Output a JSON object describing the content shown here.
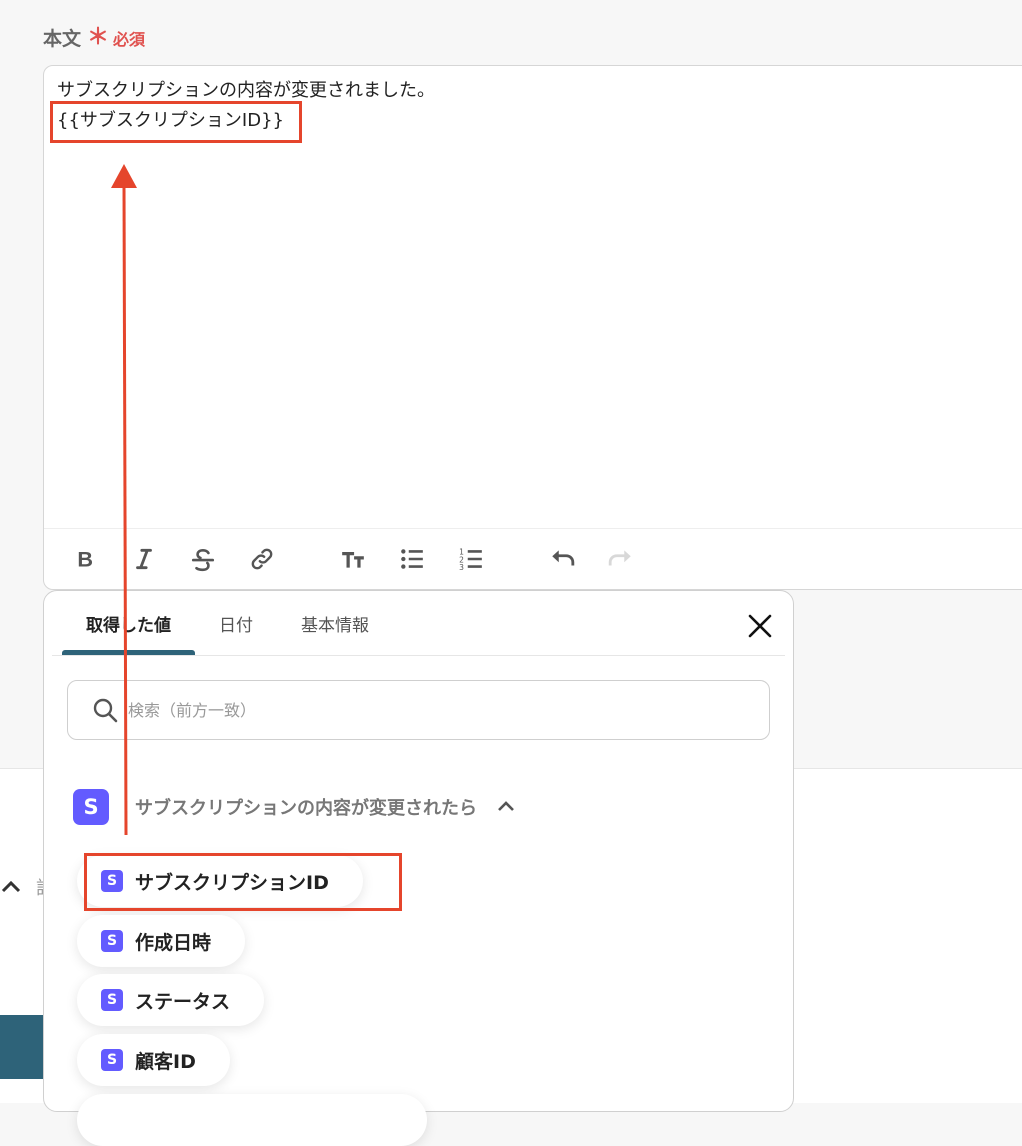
{
  "field": {
    "label": "本文",
    "required": "必須"
  },
  "editor": {
    "line1": "サブスクリプションの内容が変更されました。",
    "line2": "{{サブスクリプションID}}"
  },
  "toolbar": {
    "buttons": [
      "bold-icon",
      "italic-icon",
      "strikethrough-icon",
      "link-icon",
      "text-size-icon",
      "bulleted-list-icon",
      "numbered-list-icon",
      "undo-icon",
      "redo-icon"
    ]
  },
  "panel": {
    "tabs": [
      {
        "label": "取得した値",
        "active": true
      },
      {
        "label": "日付",
        "active": false
      },
      {
        "label": "基本情報",
        "active": false
      }
    ],
    "search": {
      "placeholder": "検索（前方一致）"
    },
    "group": {
      "badge": "S",
      "title": "サブスクリプションの内容が変更されたら"
    },
    "items": [
      {
        "badge": "S",
        "label": "サブスクリプションID"
      },
      {
        "badge": "S",
        "label": "作成日時"
      },
      {
        "badge": "S",
        "label": "ステータス"
      },
      {
        "badge": "S",
        "label": "顧客ID"
      }
    ]
  },
  "side": {
    "char": "設"
  },
  "colors": {
    "accent": "#2e6379",
    "highlight": "#e5452c",
    "stripe": "#635bff",
    "required": "#e0524f"
  }
}
